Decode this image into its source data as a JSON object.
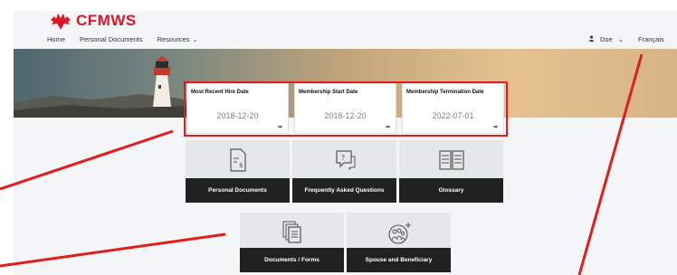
{
  "brand": {
    "name": "CFMWS",
    "color": "#d7182a"
  },
  "nav": {
    "items": [
      {
        "label": "Home"
      },
      {
        "label": "Personal Documents"
      },
      {
        "label": "Resources"
      }
    ],
    "resources_caret": "⌄"
  },
  "user": {
    "name": "Doe",
    "icon": "person-icon",
    "caret": "⌄"
  },
  "language_link": "Français",
  "cards": [
    {
      "title": "Most Recent Hire Date",
      "value": "2018-12-20",
      "arrow": "➡"
    },
    {
      "title": "Membership Start Date",
      "value": "2018-12-20",
      "arrow": "➡"
    },
    {
      "title": "Membership Termination Date",
      "value": "2022-07-01",
      "arrow": "➡"
    }
  ],
  "tiles": [
    {
      "label": "Personal Documents",
      "icon": "document-dollar-icon"
    },
    {
      "label": "Frequently Asked Questions",
      "icon": "question-chat-icon"
    },
    {
      "label": "Glossary",
      "icon": "open-book-icon"
    },
    {
      "label": "Documents / Forms",
      "icon": "documents-stack-icon"
    },
    {
      "label": "Spouse and Beneficiary",
      "icon": "family-add-icon"
    }
  ],
  "colors": {
    "highlight": "#e01e1e",
    "tile_label_bg": "#212121",
    "tile_bg": "#e4e8e9"
  }
}
